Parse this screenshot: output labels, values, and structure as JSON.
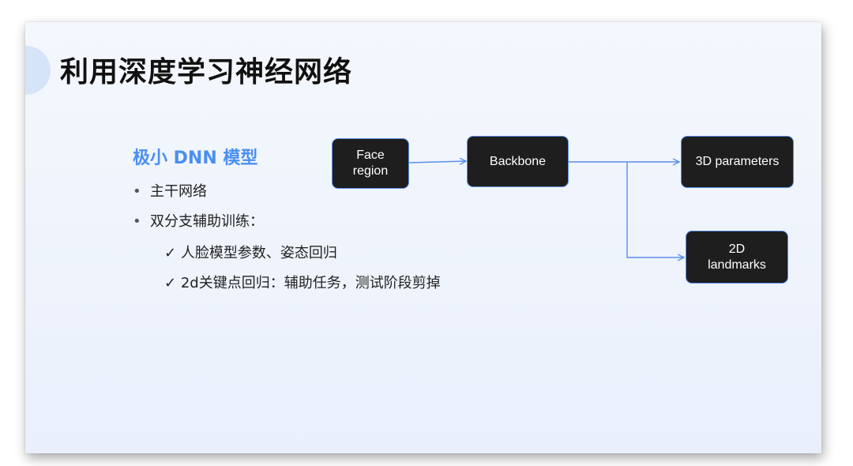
{
  "slide": {
    "title": "利用深度学习神经网络",
    "subtitle": "极小 DNN 模型",
    "bullets": [
      {
        "marker": "•",
        "text": "主干网络"
      },
      {
        "marker": "•",
        "text": "双分支辅助训练："
      }
    ],
    "checks": [
      {
        "marker": "✓",
        "text": "人脸模型参数、姿态回归"
      },
      {
        "marker": "✓",
        "text": "2d关键点回归：辅助任务，测试阶段剪掉"
      }
    ]
  },
  "diagram": {
    "nodes": {
      "face_region": "Face\nregion",
      "backbone": "Backbone",
      "params_3d": "3D parameters",
      "landmarks_2d": "2D\nlandmarks"
    }
  },
  "colors": {
    "title": "#111111",
    "subtitle": "#4b8ff0",
    "node_fill": "#1e1e1e",
    "node_border": "#5a8fe8",
    "arrow": "#5a8fe8"
  }
}
